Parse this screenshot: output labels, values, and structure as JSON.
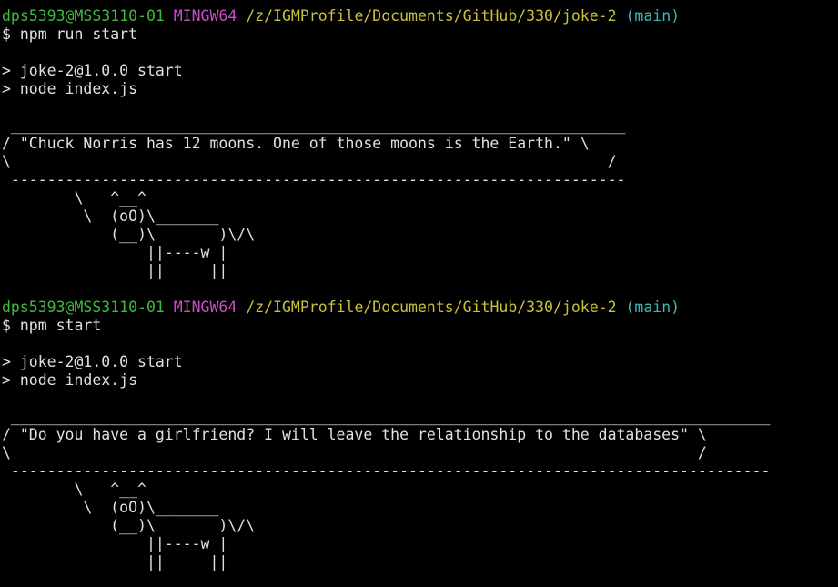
{
  "sessions": [
    {
      "prompt": {
        "user_host": "dps5393@MSS3110-01",
        "env": "MINGW64",
        "path": "/z/IGMProfile/Documents/GitHub/330/joke-2",
        "branch": "(main)"
      },
      "command": "$ npm run start",
      "output_lines": [
        "> joke-2@1.0.0 start",
        "> node index.js"
      ],
      "bubble": {
        "top": " ____________________________________________________________________",
        "line1": "/ \"Chuck Norris has 12 moons. One of those moons is the Earth.\" \\",
        "line2": "\\                                                                  /",
        "bottom": " --------------------------------------------------------------------"
      },
      "cow": [
        "        \\   ^__^",
        "         \\  (oO)\\_______",
        "            (__)\\       )\\/\\",
        "                ||----w |",
        "                ||     ||"
      ]
    },
    {
      "prompt": {
        "user_host": "dps5393@MSS3110-01",
        "env": "MINGW64",
        "path": "/z/IGMProfile/Documents/GitHub/330/joke-2",
        "branch": "(main)"
      },
      "command": "$ npm start",
      "output_lines": [
        "> joke-2@1.0.0 start",
        "> node index.js"
      ],
      "bubble": {
        "top": " ____________________________________________________________________________________",
        "line1": "/ \"Do you have a girlfriend? I will leave the relationship to the databases\" \\",
        "line2": "\\                                                                            /",
        "bottom": " ------------------------------------------------------------------------------------"
      },
      "cow": [
        "        \\   ^__^",
        "         \\  (oO)\\_______",
        "            (__)\\       )\\/\\",
        "                ||----w |",
        "                ||     ||"
      ]
    }
  ],
  "colors": {
    "background": "#000000",
    "user_host": "#3fba3f",
    "env": "#c64fc6",
    "path": "#c8c23a",
    "branch": "#3fb6b6",
    "text": "#e0e0e0"
  }
}
